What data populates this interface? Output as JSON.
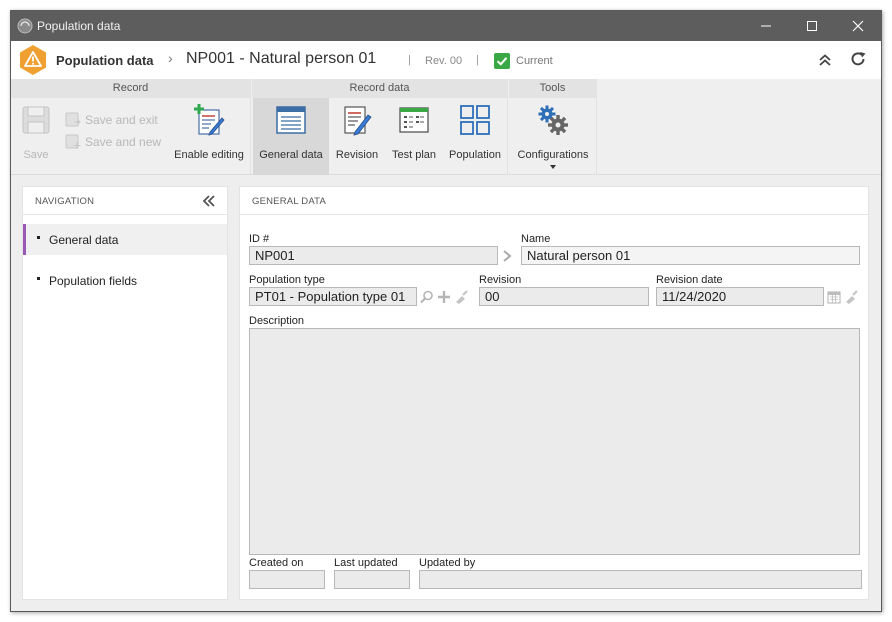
{
  "window": {
    "title": "Population data"
  },
  "header": {
    "title": "Population data",
    "separator": "›",
    "record": "NP001 - Natural person 01",
    "revision": "Rev. 00",
    "status": "Current",
    "divider": "|"
  },
  "ribbon": {
    "groups": {
      "record": "Record",
      "record_data": "Record data",
      "tools": "Tools"
    },
    "buttons": {
      "save": "Save",
      "save_and_exit": "Save and exit",
      "save_and_new": "Save and new",
      "enable_editing": "Enable editing",
      "general_data": "General data",
      "revision": "Revision",
      "test_plan": "Test plan",
      "population": "Population",
      "configurations": "Configurations"
    }
  },
  "navigation": {
    "title": "NAVIGATION",
    "items": [
      {
        "label": "General data",
        "active": true
      },
      {
        "label": "Population fields",
        "active": false
      }
    ]
  },
  "main": {
    "title": "GENERAL DATA",
    "fields": {
      "id_label": "ID #",
      "id_value": "NP001",
      "name_label": "Name",
      "name_value": "Natural person 01",
      "population_type_label": "Population type",
      "population_type_value": "PT01 - Population type 01",
      "revision_label": "Revision",
      "revision_value": "00",
      "revision_date_label": "Revision date",
      "revision_date_value": "11/24/2020",
      "description_label": "Description",
      "description_value": "",
      "created_on_label": "Created on",
      "created_on_value": "",
      "last_updated_label": "Last updated",
      "last_updated_value": "",
      "updated_by_label": "Updated by",
      "updated_by_value": ""
    }
  },
  "colors": {
    "titlebar": "#5d5d5d",
    "accent_nav": "#9b59b6",
    "status_green": "#3aa845",
    "warning_orange": "#f0a030"
  }
}
